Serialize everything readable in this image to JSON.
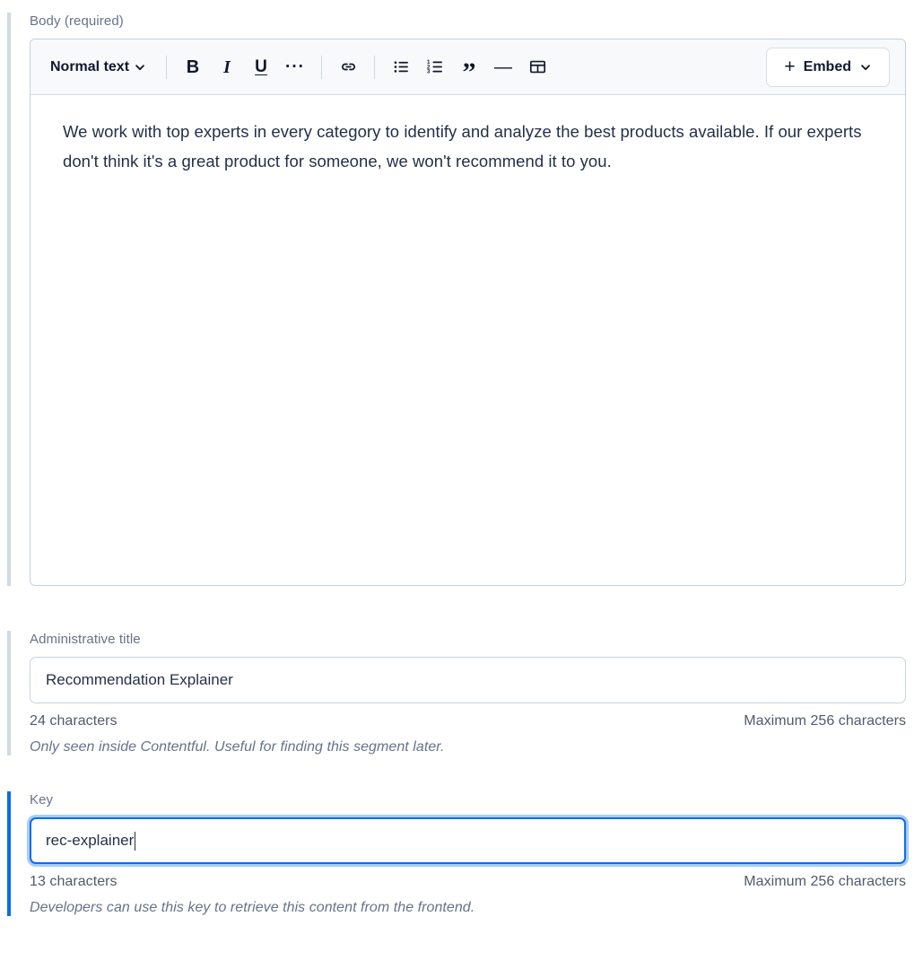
{
  "body_field": {
    "label": "Body (required)",
    "toolbar": {
      "block_style": "Normal text",
      "block_style_chevron": "chevron-down-icon",
      "buttons": [
        {
          "name": "bold-icon",
          "glyph": "B",
          "title": "Bold"
        },
        {
          "name": "italic-icon",
          "glyph": "I",
          "title": "Italic"
        },
        {
          "name": "underline-icon",
          "glyph": "U",
          "title": "Underline"
        },
        {
          "name": "more-options-icon",
          "glyph": "···",
          "title": "More"
        },
        {
          "name": "link-icon",
          "glyph": "",
          "title": "Hyperlink"
        },
        {
          "name": "unordered-list-icon",
          "glyph": "",
          "title": "Unordered list"
        },
        {
          "name": "ordered-list-icon",
          "glyph": "",
          "title": "Ordered list"
        },
        {
          "name": "blockquote-icon",
          "glyph": "”",
          "title": "Blockquote"
        },
        {
          "name": "horizontal-rule-icon",
          "glyph": "—",
          "title": "Horizontal rule"
        },
        {
          "name": "table-icon",
          "glyph": "",
          "title": "Table"
        }
      ],
      "embed_label": "Embed",
      "embed_plus": "+",
      "embed_chevron": "chevron-down-icon"
    },
    "content": "We work with top experts in every category to identify and analyze the best products available. If our experts don't think it's a great product for someone, we won't recommend it to you."
  },
  "administrative_title_field": {
    "label": "Administrative title",
    "value": "Recommendation Explainer",
    "placeholder": "",
    "character_count": "24 characters",
    "maximum": "Maximum 256 characters",
    "help_text": "Only seen inside Contentful. Useful for finding this segment later."
  },
  "key_field": {
    "label": "Key",
    "value": "rec-explainer",
    "placeholder": "",
    "character_count": "13 characters",
    "maximum": "Maximum 256 characters",
    "help_text": "Developers can use this key to retrieve this content from the frontend.",
    "focused": true
  },
  "colors": {
    "accent_blue": "#0d6ce6",
    "accent_blue_ring": "#a7cdf7",
    "accent_bar_idle": "#cfdae3",
    "label_text": "#67728a",
    "body_text": "#243049",
    "border": "#c9d4de",
    "toolbar_bg": "#f7f9fa"
  }
}
